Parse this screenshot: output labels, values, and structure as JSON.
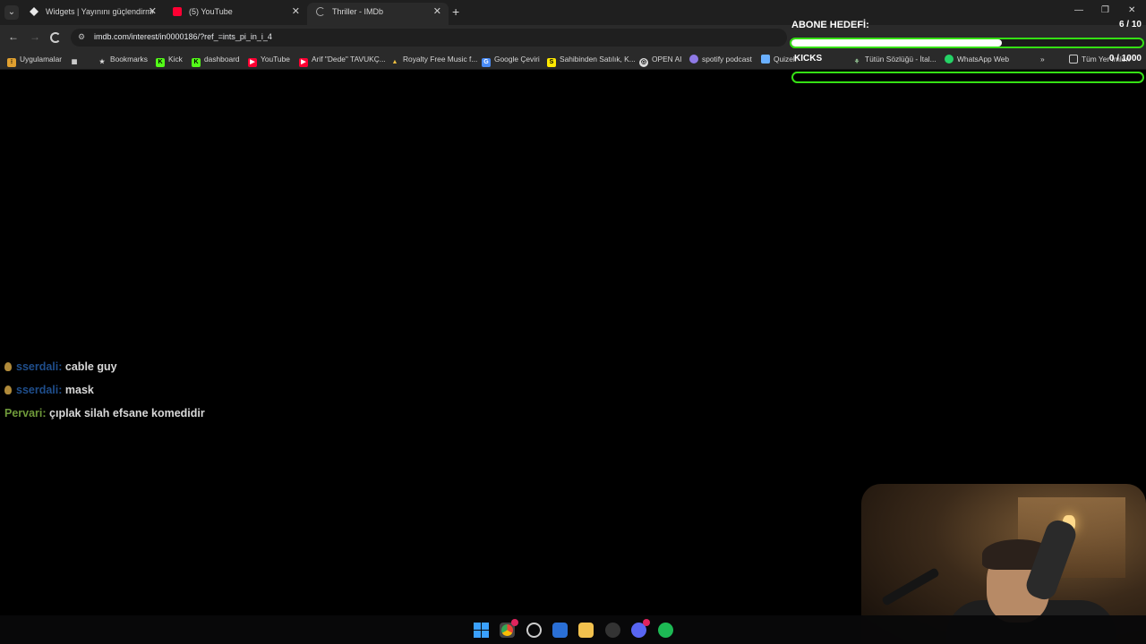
{
  "tabs": [
    {
      "label": "Widgets | Yayınını güçlendirmek",
      "active": false
    },
    {
      "label": "(5) YouTube",
      "active": false
    },
    {
      "label": "Thriller - IMDb",
      "active": true
    }
  ],
  "toolbar": {
    "url": "imdb.com/interest/in0000186/?ref_=ints_pi_in_i_4"
  },
  "bookmarks": {
    "items": [
      {
        "label": "Uygulamalar",
        "icon": "apps-grid-icon"
      },
      {
        "label": "Bookmarks",
        "icon": "star-icon"
      },
      {
        "label": "Kick",
        "icon": "kick-icon"
      },
      {
        "label": "dashboard",
        "icon": "kick-icon"
      },
      {
        "label": "YouTube",
        "icon": "youtube-icon"
      },
      {
        "label": "Arif \"Dede\" TAVUKÇ...",
        "icon": "youtube-icon"
      },
      {
        "label": "Royalty Free Music f...",
        "icon": "triangle-icon"
      },
      {
        "label": "Google Çeviri",
        "icon": "translate-icon"
      },
      {
        "label": "Sahibinden Satılık, K...",
        "icon": "sahibinden-icon"
      },
      {
        "label": "OPEN AI",
        "icon": "openai-icon"
      },
      {
        "label": "spotify podcast",
        "icon": "podcast-icon"
      },
      {
        "label": "Quizell",
        "icon": "quiz-icon"
      },
      {
        "label": "Tütün Sözlüğü - İtal...",
        "icon": "leaf-icon"
      },
      {
        "label": "WhatsApp Web",
        "icon": "whatsapp-icon"
      }
    ],
    "all_bookmarks_label": "Tüm Yer İmleri"
  },
  "overlay": {
    "goal_title": "ABONE HEDEFİ:",
    "goal_count": "6 / 10",
    "goal_progress": 0.6,
    "kicks_title": "KICKS",
    "kicks_count": "0 / 1000",
    "kicks_progress": 0
  },
  "chat": [
    {
      "user": "sserdali:",
      "message": "cable guy",
      "color": "blue",
      "badge": true
    },
    {
      "user": "sserdali:",
      "message": "mask",
      "color": "blue",
      "badge": true
    },
    {
      "user": "Pervari:",
      "message": "çıplak silah efsane komedidir",
      "color": "green",
      "badge": false
    }
  ],
  "colors": {
    "accent_green": "#35e014",
    "tab_bg": "#1f1f1f",
    "toolbar_bg": "#2a2a2a"
  }
}
